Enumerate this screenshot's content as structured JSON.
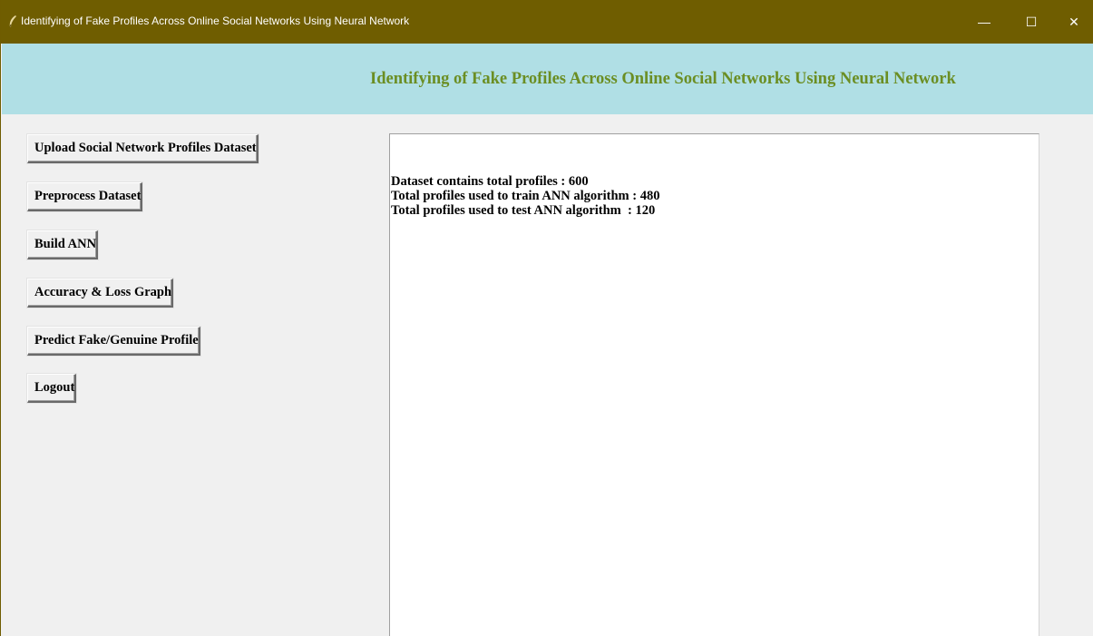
{
  "window": {
    "title": "Identifying of Fake Profiles Across Online Social Networks Using Neural Network",
    "controls": {
      "minimize": "—",
      "maximize": "☐",
      "close": "✕"
    },
    "titlebar_color": "#6f5d00"
  },
  "header": {
    "heading": "Identifying of Fake Profiles Across Online Social Networks Using Neural Network",
    "background": "#b0dfe5",
    "text_color": "#6b8e23"
  },
  "buttons": {
    "upload": "Upload Social Network Profiles Dataset",
    "preprocess": "Preprocess Dataset",
    "build": "Build ANN",
    "graph": "Accuracy & Loss Graph",
    "predict": "Predict Fake/Genuine Profile",
    "logout": "Logout"
  },
  "output": {
    "lines": [
      "Dataset contains total profiles : 600",
      "Total profiles used to train ANN algorithm : 480",
      "Total profiles used to test ANN algorithm  : 120"
    ]
  }
}
